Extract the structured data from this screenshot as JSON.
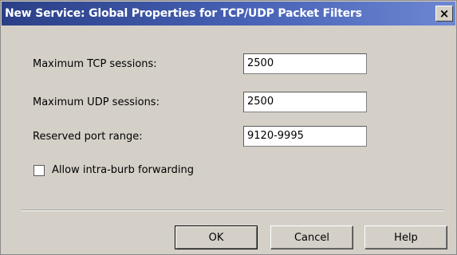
{
  "window": {
    "title": "New Service: Global Properties for TCP/UDP Packet Filters",
    "close_symbol": "×",
    "close_icon": "close-icon"
  },
  "form": {
    "fields": [
      {
        "label": "Maximum TCP sessions:",
        "value": "2500"
      },
      {
        "label": "Maximum UDP sessions:",
        "value": "2500"
      },
      {
        "label": "Reserved port range:",
        "value": "9120-9995"
      }
    ],
    "checkbox": {
      "label": "Allow intra-burb forwarding",
      "checked": false
    }
  },
  "buttons": {
    "ok": "OK",
    "cancel": "Cancel",
    "help": "Help"
  },
  "colors": {
    "titlebar_start": "#2a3f86",
    "titlebar_end": "#6d87d2",
    "dialog_bg": "#d4d0c8"
  }
}
